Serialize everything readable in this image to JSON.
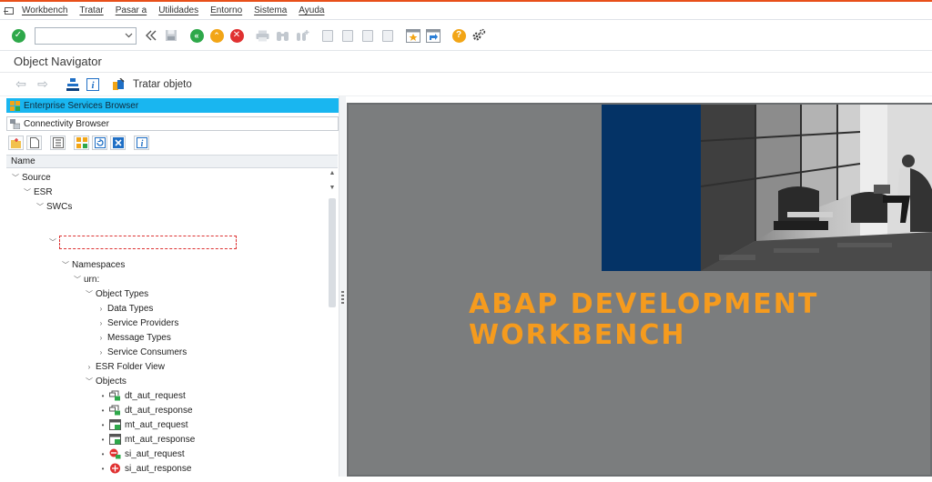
{
  "menu": {
    "items": [
      "Workbench",
      "Tratar",
      "Pasar a",
      "Utilidades",
      "Entorno",
      "Sistema",
      "Ayuda"
    ]
  },
  "toolbar": {
    "command_field_value": ""
  },
  "title": "Object Navigator",
  "app_toolbar": {
    "edit_object_label": "Tratar objeto"
  },
  "browsers": {
    "enterprise_services": "Enterprise Services Browser",
    "connectivity": "Connectivity Browser"
  },
  "tree": {
    "column_header": "Name",
    "nodes": {
      "source": "Source",
      "esr": "ESR",
      "swcs": "SWCs",
      "namespaces": "Namespaces",
      "urn": "urn:",
      "object_types": "Object Types",
      "data_types": "Data Types",
      "service_providers": "Service Providers",
      "message_types": "Message Types",
      "service_consumers": "Service Consumers",
      "esr_folder_view": "ESR Folder View",
      "objects": "Objects"
    },
    "objects": [
      "dt_aut_request",
      "dt_aut_response",
      "mt_aut_request",
      "mt_aut_response",
      "si_aut_request",
      "si_aut_response"
    ]
  },
  "splash": {
    "line1": "ABAP DEVELOPMENT",
    "line2": "WORKBENCH"
  },
  "colors": {
    "accent_orange": "#f59b1e",
    "sap_blue": "#043366",
    "selected_browser": "#19b6f0",
    "splash_background": "#7b7d7e"
  }
}
